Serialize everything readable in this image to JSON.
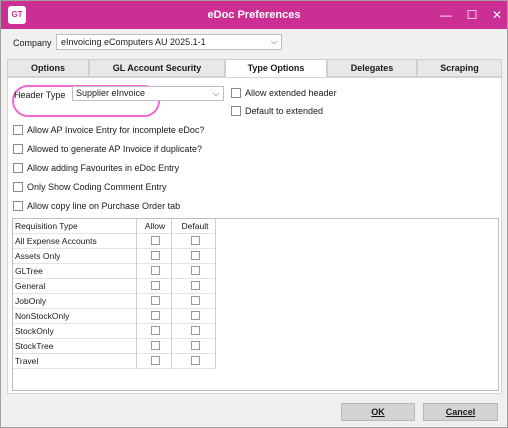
{
  "window": {
    "app_icon_text": "GT",
    "title": "eDoc Preferences",
    "minimize": "—",
    "maximize": "☐",
    "close": "✕"
  },
  "company": {
    "label": "Company",
    "value": "eInvoicing eComputers AU 2025.1-1"
  },
  "tabs": [
    {
      "label": "Options",
      "active": false
    },
    {
      "label": "GL Account Security",
      "active": false
    },
    {
      "label": "Type Options",
      "active": true
    },
    {
      "label": "Delegates",
      "active": false
    },
    {
      "label": "Scraping",
      "active": false
    }
  ],
  "header_type": {
    "label": "Header Type",
    "value": "Supplier eInvoice",
    "highlight_color": "#f06acf"
  },
  "options": {
    "allow_extended_header": "Allow extended header",
    "default_to_extended": "Default to extended",
    "allow_ap_incomplete": "Allow AP Invoice Entry for incomplete eDoc?",
    "allowed_generate_duplicate": "Allowed to generate AP Invoice if duplicate?",
    "allow_favourites": "Allow adding Favourites in eDoc Entry",
    "only_show_coding": "Only Show Coding Comment Entry",
    "allow_copy_line": "Allow copy line on Purchase Order tab"
  },
  "requisition": {
    "headers": {
      "type": "Requisition Type",
      "allow": "Allow",
      "default": "Default"
    },
    "rows": [
      {
        "type": "All Expense Accounts"
      },
      {
        "type": "Assets Only"
      },
      {
        "type": "GLTree"
      },
      {
        "type": "General"
      },
      {
        "type": "JobOnly"
      },
      {
        "type": "NonStockOnly"
      },
      {
        "type": "StockOnly"
      },
      {
        "type": "StockTree"
      },
      {
        "type": "Travel"
      }
    ]
  },
  "buttons": {
    "ok": "OK",
    "cancel": "Cancel"
  },
  "colors": {
    "titlebar": "#cc2f94",
    "window_bg": "#f0f0f0"
  }
}
